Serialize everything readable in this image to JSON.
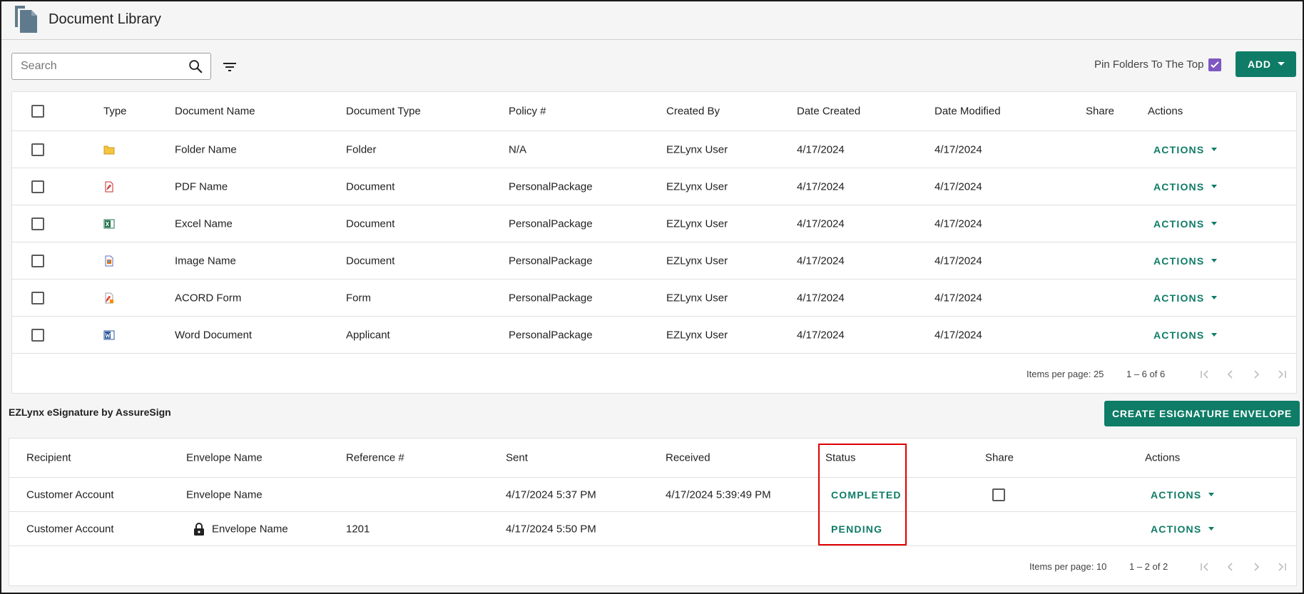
{
  "header": {
    "title": "Document Library",
    "app_icon": "documents-icon"
  },
  "toolbar": {
    "search_placeholder": "Search",
    "search_value": "",
    "pin_label": "Pin Folders To The Top",
    "pin_checked": true,
    "add_label": "ADD"
  },
  "documents": {
    "columns": [
      "Type",
      "Document Name",
      "Document Type",
      "Policy #",
      "Created By",
      "Date Created",
      "Date Modified",
      "Share",
      "Actions"
    ],
    "rows": [
      {
        "icon": "folder-icon",
        "name": "Folder Name",
        "doc_type": "Folder",
        "policy": "N/A",
        "created_by": "EZLynx User",
        "date_created": "4/17/2024",
        "date_modified": "4/17/2024",
        "action": "ACTIONS"
      },
      {
        "icon": "pdf-icon",
        "name": "PDF Name",
        "doc_type": "Document",
        "policy": "PersonalPackage",
        "created_by": "EZLynx User",
        "date_created": "4/17/2024",
        "date_modified": "4/17/2024",
        "action": "ACTIONS"
      },
      {
        "icon": "excel-icon",
        "name": "Excel Name",
        "doc_type": "Document",
        "policy": "PersonalPackage",
        "created_by": "EZLynx User",
        "date_created": "4/17/2024",
        "date_modified": "4/17/2024",
        "action": "ACTIONS"
      },
      {
        "icon": "image-icon",
        "name": "Image Name",
        "doc_type": "Document",
        "policy": "PersonalPackage",
        "created_by": "EZLynx User",
        "date_created": "4/17/2024",
        "date_modified": "4/17/2024",
        "action": "ACTIONS"
      },
      {
        "icon": "acord-form-icon",
        "name": "ACORD Form",
        "doc_type": "Form",
        "policy": "PersonalPackage",
        "created_by": "EZLynx User",
        "date_created": "4/17/2024",
        "date_modified": "4/17/2024",
        "action": "ACTIONS"
      },
      {
        "icon": "word-icon",
        "name": "Word Document",
        "doc_type": "Applicant",
        "policy": "PersonalPackage",
        "created_by": "EZLynx User",
        "date_created": "4/17/2024",
        "date_modified": "4/17/2024",
        "action": "ACTIONS"
      }
    ],
    "pager": {
      "items_per_page": "Items per page: 25",
      "range": "1 – 6 of 6"
    }
  },
  "esignature": {
    "title": "EZLynx eSignature by AssureSign",
    "create_label": "CREATE ESIGNATURE ENVELOPE",
    "columns": [
      "Recipient",
      "Envelope Name",
      "Reference #",
      "Sent",
      "Received",
      "Status",
      "Share",
      "Actions"
    ],
    "rows": [
      {
        "recipient": "Customer Account",
        "envelope": "Envelope Name",
        "locked": false,
        "reference": "",
        "sent": "4/17/2024 5:37 PM",
        "received": "4/17/2024 5:39:49 PM",
        "status": "COMPLETED",
        "share_checkbox": true,
        "action": "ACTIONS"
      },
      {
        "recipient": "Customer Account",
        "envelope": "Envelope Name",
        "locked": true,
        "reference": "1201",
        "sent": "4/17/2024 5:50 PM",
        "received": "",
        "status": "PENDING",
        "share_checkbox": false,
        "action": "ACTIONS"
      }
    ],
    "pager": {
      "items_per_page": "Items per page: 10",
      "range": "1 – 2 of 2"
    }
  },
  "colors": {
    "accent": "#0e7c66",
    "pin_checkbox": "#7e57c2",
    "highlight": "#e00000"
  }
}
